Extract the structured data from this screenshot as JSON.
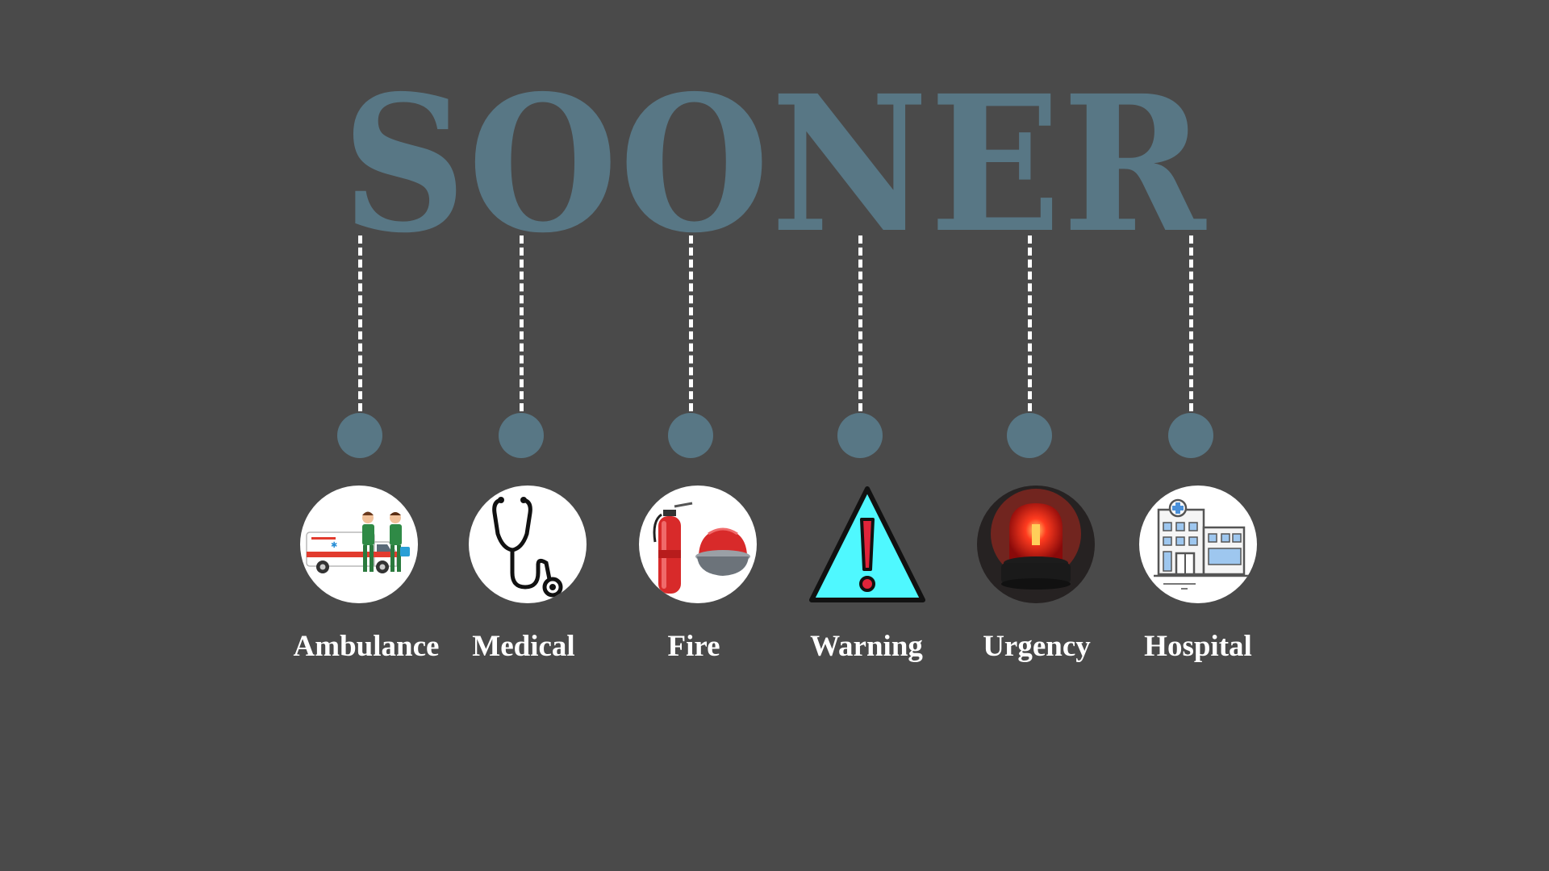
{
  "title": "SOONER",
  "colors": {
    "background": "#4a4a4a",
    "accent": "#587785",
    "connector": "#ffffff",
    "label": "#ffffff"
  },
  "items": [
    {
      "label": "Ambulance",
      "icon": "ambulance-icon"
    },
    {
      "label": "Medical",
      "icon": "stethoscope-icon"
    },
    {
      "label": "Fire",
      "icon": "fire-extinguisher-helmet-icon"
    },
    {
      "label": "Warning",
      "icon": "warning-triangle-icon"
    },
    {
      "label": "Urgency",
      "icon": "siren-light-icon"
    },
    {
      "label": "Hospital",
      "icon": "hospital-building-icon"
    }
  ]
}
